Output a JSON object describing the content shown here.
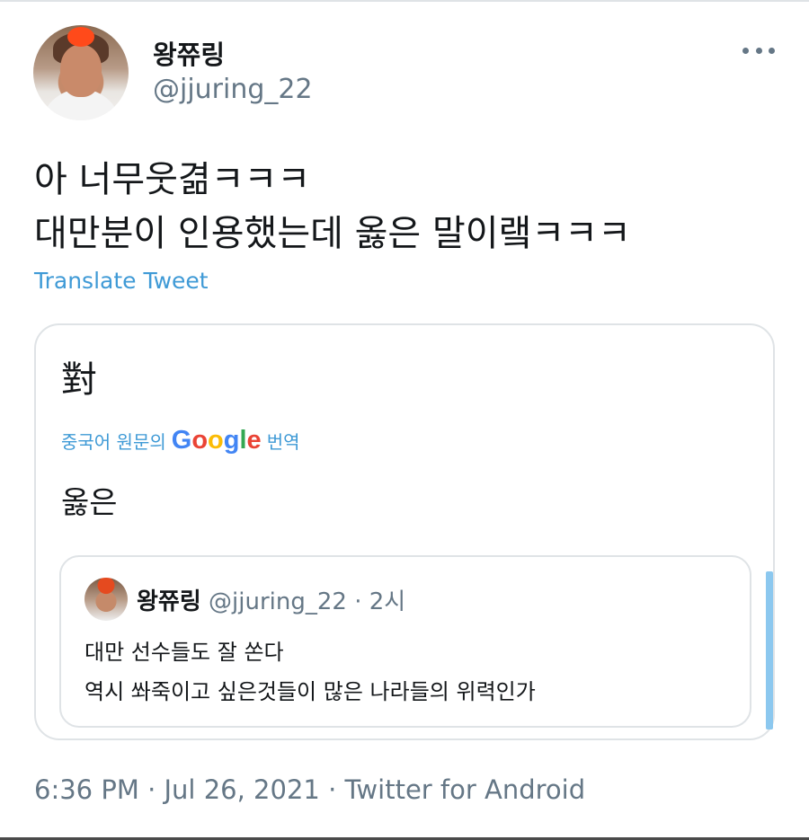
{
  "tweet": {
    "display_name": "왕쮸링",
    "handle": "@jjuring_22",
    "text_lines": [
      "아 너무웃겲ㅋㅋㅋ",
      "대만분이 인용했는데 옳은 말이랰ㅋㅋㅋ"
    ],
    "translate_label": "Translate Tweet",
    "meta": "6:36 PM · Jul 26, 2021 · Twitter for Android"
  },
  "quote": {
    "text": "對",
    "translation_prefix": "중국어 원문의",
    "translation_brand": "Google",
    "translation_suffix": "번역",
    "translated_text": "옳은",
    "nested": {
      "display_name": "왕쮸링",
      "handle_time": "@jjuring_22 · 2시",
      "lines": [
        "대만 선수들도 잘 쏜다",
        "역시 쏴죽이고 싶은것들이 많은 나라들의 위력인가"
      ]
    }
  },
  "icons": {
    "more": "more-horizontal-icon"
  },
  "colors": {
    "link": "#3f9ad6",
    "muted": "#657786",
    "border": "#dfe3e6"
  }
}
